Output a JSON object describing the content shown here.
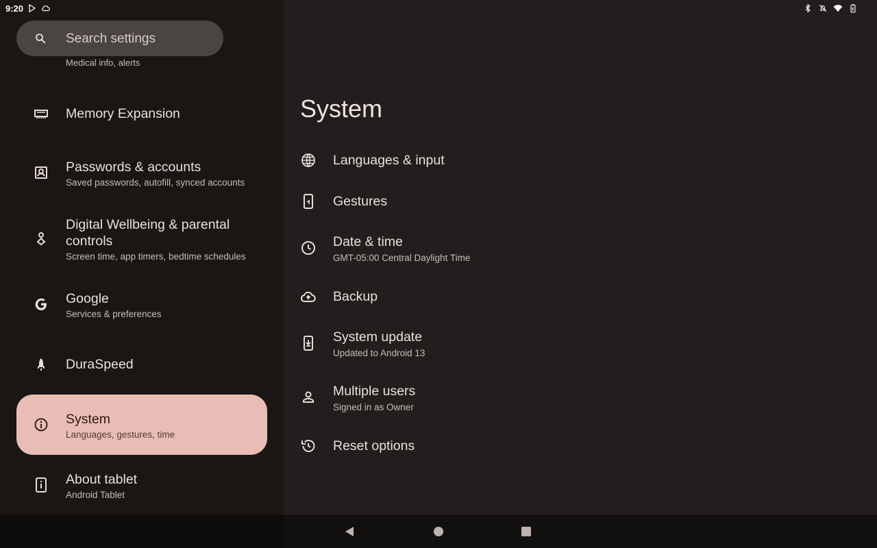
{
  "status_bar": {
    "time": "9:20",
    "left_icons": [
      "play-store-icon",
      "cloud-sync-icon"
    ],
    "right_icons": [
      "bluetooth-icon",
      "notifications-off-icon",
      "wifi-icon",
      "battery-icon"
    ]
  },
  "search": {
    "placeholder": "Search settings"
  },
  "left_nav": {
    "cut_item_summary": "Medical info, alerts",
    "items": [
      {
        "icon": "memory-icon",
        "title": "Memory Expansion",
        "summary": ""
      },
      {
        "icon": "account-box-icon",
        "title": "Passwords & accounts",
        "summary": "Saved passwords, autofill, synced accounts"
      },
      {
        "icon": "wellbeing-icon",
        "title": "Digital Wellbeing & parental controls",
        "summary": "Screen time, app timers, bedtime schedules"
      },
      {
        "icon": "google-icon",
        "title": "Google",
        "summary": "Services & preferences"
      },
      {
        "icon": "rocket-icon",
        "title": "DuraSpeed",
        "summary": ""
      },
      {
        "icon": "info-icon",
        "title": "System",
        "summary": "Languages, gestures, time",
        "selected": true
      },
      {
        "icon": "tablet-info-icon",
        "title": "About tablet",
        "summary": "Android Tablet"
      }
    ]
  },
  "main": {
    "title": "System",
    "items": [
      {
        "icon": "globe-icon",
        "title": "Languages & input",
        "summary": ""
      },
      {
        "icon": "gestures-icon",
        "title": "Gestures",
        "summary": ""
      },
      {
        "icon": "clock-icon",
        "title": "Date & time",
        "summary": "GMT-05:00 Central Daylight Time"
      },
      {
        "icon": "cloud-upload-icon",
        "title": "Backup",
        "summary": ""
      },
      {
        "icon": "system-update-icon",
        "title": "System update",
        "summary": "Updated to Android 13"
      },
      {
        "icon": "person-icon",
        "title": "Multiple users",
        "summary": "Signed in as Owner"
      },
      {
        "icon": "history-icon",
        "title": "Reset options",
        "summary": ""
      }
    ]
  },
  "nav_bar": {
    "buttons": [
      "back-icon",
      "home-icon",
      "recents-icon"
    ]
  },
  "colors": {
    "selected_bg": "#e8bdb5",
    "left_bg": "#1a1614",
    "right_bg": "#221e1d",
    "search_bg": "#4a4442"
  }
}
